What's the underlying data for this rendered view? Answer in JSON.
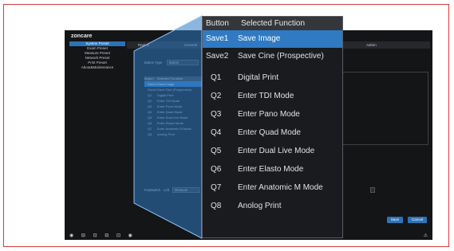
{
  "screen": {
    "logo": "zoncare",
    "left_nav": [
      {
        "label": "System Preset",
        "selected": true
      },
      {
        "label": "Exam Preset",
        "selected": false
      },
      {
        "label": "Measure Preset",
        "selected": false
      },
      {
        "label": "Network Preset",
        "selected": false
      },
      {
        "label": "Print Preset",
        "selected": false
      },
      {
        "label": "About&Maintenance",
        "selected": false
      }
    ],
    "tabs": [
      {
        "label": "Region",
        "selected": false
      },
      {
        "label": "General",
        "selected": false
      },
      {
        "label": "Admin",
        "selected": false
      }
    ],
    "button_type_label": "Button Type",
    "button_type_value": "Button",
    "footswitch_label": "Footswitch",
    "footswitch_left": "Left",
    "footswitch_value": "Measure",
    "save_button": "Save",
    "cancel_button": "Cancel",
    "status_icons": "◉ ⊟ ⊡ ⊟ ⊡ ◉",
    "status_right": "⚠"
  },
  "zoom_table": {
    "header": {
      "button": "Button",
      "function": "Selected Function"
    },
    "rows": [
      {
        "key": "Save1",
        "function": "Save Image",
        "selected": true
      },
      {
        "key": "Save2",
        "function": "Save Cine (Prospective)",
        "selected": false
      },
      {
        "key": "Q1",
        "function": "Digital Print",
        "selected": false
      },
      {
        "key": "Q2",
        "function": "Enter TDI Mode",
        "selected": false
      },
      {
        "key": "Q3",
        "function": "Enter Pano Mode",
        "selected": false
      },
      {
        "key": "Q4",
        "function": "Enter Quad Mode",
        "selected": false
      },
      {
        "key": "Q5",
        "function": "Enter Dual Live Mode",
        "selected": false
      },
      {
        "key": "Q6",
        "function": "Enter Elasto Mode",
        "selected": false
      },
      {
        "key": "Q7",
        "function": "Enter Anatomic M Mode",
        "selected": false
      },
      {
        "key": "Q8",
        "function": "Anolog Print",
        "selected": false
      }
    ]
  },
  "colors": {
    "frame_border": "#d23b3b",
    "accent_blue": "#2f7ac2",
    "screen_bg": "#141517"
  }
}
